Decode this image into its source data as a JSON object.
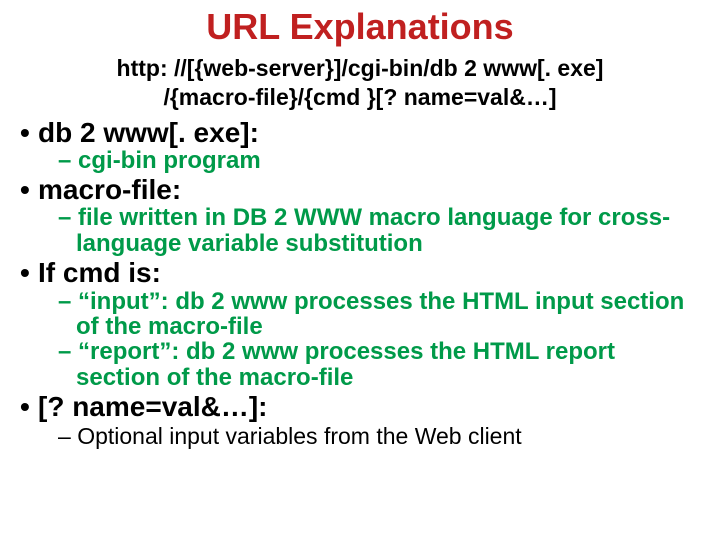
{
  "title": "URL Explanations",
  "url_line1": "http: //[{web-server}]/cgi-bin/db 2 www[. exe]",
  "url_line2": "/{macro-file}/{cmd }[? name=val&…]",
  "items": [
    {
      "head": "db 2 www[. exe]:",
      "head_green": true,
      "sub_style": "comic",
      "subs": [
        "cgi-bin program"
      ]
    },
    {
      "head": "macro-file:",
      "head_green": true,
      "sub_style": "comic",
      "subs": [
        "file written in DB 2 WWW macro language for cross-language variable substitution"
      ]
    },
    {
      "head": "If cmd is:",
      "head_green": true,
      "sub_style": "comic",
      "subs": [
        "“input”:    db 2 www processes the HTML input section of the macro-file",
        "“report”: db 2 www processes the HTML report section of the macro-file"
      ]
    },
    {
      "head": "[? name=val&…]:",
      "head_green": true,
      "sub_style": "arial",
      "subs": [
        "Optional input variables from the Web client"
      ]
    }
  ]
}
